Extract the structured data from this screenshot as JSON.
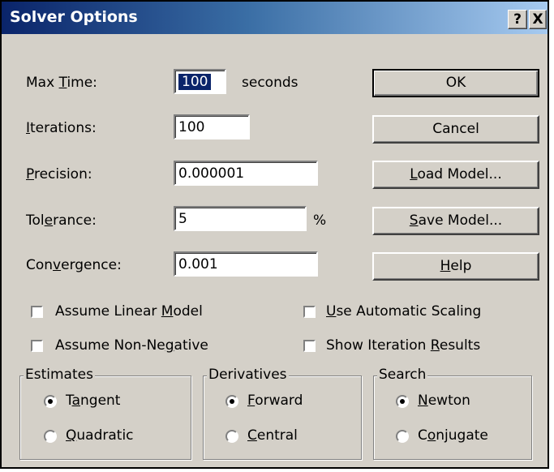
{
  "window": {
    "title": "Solver Options",
    "help_glyph": "?",
    "close_glyph": "X"
  },
  "fields": {
    "max_time": {
      "pre": "Max ",
      "key": "T",
      "post": "ime:",
      "value": "100",
      "unit": "seconds"
    },
    "iterations": {
      "pre": "",
      "key": "I",
      "post": "terations:",
      "value": "100"
    },
    "precision": {
      "pre": "",
      "key": "P",
      "post": "recision:",
      "value": "0.000001"
    },
    "tolerance": {
      "pre": "Tol",
      "key": "e",
      "post": "rance:",
      "value": "5",
      "unit": "%"
    },
    "convergence": {
      "pre": "Con",
      "key": "v",
      "post": "ergence:",
      "value": "0.001"
    }
  },
  "buttons": {
    "ok": {
      "pre": "OK",
      "key": "",
      "post": ""
    },
    "cancel": {
      "pre": "Cancel",
      "key": "",
      "post": ""
    },
    "load": {
      "pre": "",
      "key": "L",
      "post": "oad Model..."
    },
    "save": {
      "pre": "",
      "key": "S",
      "post": "ave Model..."
    },
    "help": {
      "pre": "",
      "key": "H",
      "post": "elp"
    }
  },
  "checkboxes": {
    "linear": {
      "pre": "Assume Linear ",
      "key": "M",
      "post": "odel",
      "checked": false
    },
    "nonneg": {
      "pre": "Assume Non-Ne",
      "key": "g",
      "post": "ative",
      "checked": false
    },
    "scaling": {
      "pre": "",
      "key": "U",
      "post": "se Automatic Scaling",
      "checked": false
    },
    "iter_results": {
      "pre": "Show Iteration ",
      "key": "R",
      "post": "esults",
      "checked": false
    }
  },
  "groups": {
    "estimates": {
      "label": "Estimates",
      "opt1": {
        "pre": "T",
        "key": "a",
        "post": "ngent",
        "selected": true
      },
      "opt2": {
        "pre": "",
        "key": "Q",
        "post": "uadratic",
        "selected": false
      }
    },
    "derivatives": {
      "label": "Derivatives",
      "opt1": {
        "pre": "",
        "key": "F",
        "post": "orward",
        "selected": true
      },
      "opt2": {
        "pre": "",
        "key": "C",
        "post": "entral",
        "selected": false
      }
    },
    "search": {
      "label": "Search",
      "opt1": {
        "pre": "",
        "key": "N",
        "post": "ewton",
        "selected": true
      },
      "opt2": {
        "pre": "C",
        "key": "o",
        "post": "njugate",
        "selected": false
      }
    }
  }
}
